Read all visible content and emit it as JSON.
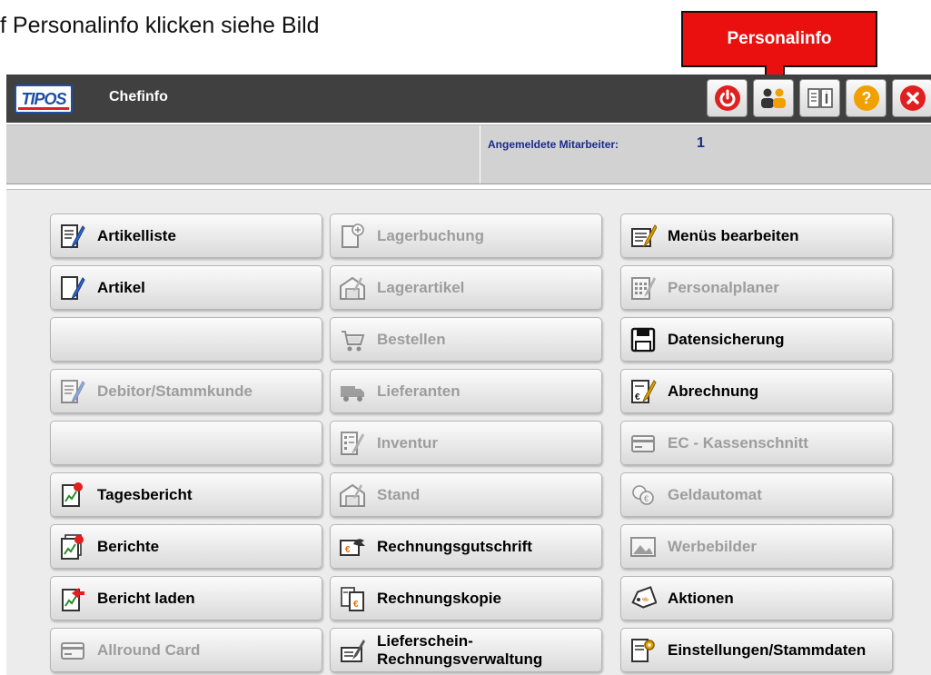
{
  "caption": "f Personalinfo klicken siehe Bild",
  "callout": {
    "label": "Personalinfo"
  },
  "window": {
    "logo_text": "TIPOS",
    "title": "Chefinfo",
    "toolbar": [
      {
        "name": "power-button",
        "icon": "power-icon",
        "color": "#e02020"
      },
      {
        "name": "personalinfo-button",
        "icon": "users-icon",
        "color": "#f0a000"
      },
      {
        "name": "info-book-button",
        "icon": "book-icon",
        "color": "#555555"
      },
      {
        "name": "help-button",
        "icon": "question-icon",
        "color": "#f0a000"
      },
      {
        "name": "close-button",
        "icon": "close-icon",
        "color": "#e02020"
      }
    ]
  },
  "status": {
    "label": "Angemeldete Mitarbeiter:",
    "value": "1"
  },
  "menu": {
    "col1": [
      {
        "label": "Artikelliste",
        "enabled": true,
        "icon": "edit-list-icon"
      },
      {
        "label": "Artikel",
        "enabled": true,
        "icon": "edit-document-icon"
      },
      {
        "label": "",
        "enabled": true,
        "icon": ""
      },
      {
        "label": "Debitor/Stammkunde",
        "enabled": false,
        "icon": "edit-list-icon"
      },
      {
        "label": "",
        "enabled": true,
        "icon": ""
      },
      {
        "label": "Tagesbericht",
        "enabled": true,
        "icon": "report-icon"
      },
      {
        "label": "Berichte",
        "enabled": true,
        "icon": "reports-icon"
      },
      {
        "label": "Bericht laden",
        "enabled": true,
        "icon": "load-report-icon"
      },
      {
        "label": "Allround Card",
        "enabled": false,
        "icon": "card-icon"
      }
    ],
    "col2": [
      {
        "label": "Lagerbuchung",
        "enabled": false,
        "icon": "add-document-icon"
      },
      {
        "label": "Lagerartikel",
        "enabled": false,
        "icon": "warehouse-icon"
      },
      {
        "label": "Bestellen",
        "enabled": false,
        "icon": "cart-icon"
      },
      {
        "label": "Lieferanten",
        "enabled": false,
        "icon": "truck-icon"
      },
      {
        "label": "Inventur",
        "enabled": false,
        "icon": "checklist-icon"
      },
      {
        "label": "Stand",
        "enabled": false,
        "icon": "warehouse-icon"
      },
      {
        "label": "Rechnungsgutschrift",
        "enabled": true,
        "icon": "credit-note-icon"
      },
      {
        "label": "Rechnungskopie",
        "enabled": true,
        "icon": "invoice-copy-icon"
      },
      {
        "label": "Lieferschein-\nRechnungsverwaltung",
        "enabled": true,
        "icon": "delivery-note-icon"
      }
    ],
    "col3": [
      {
        "label": "Menüs bearbeiten",
        "enabled": true,
        "icon": "edit-menu-icon"
      },
      {
        "label": "Personalplaner",
        "enabled": false,
        "icon": "calendar-icon"
      },
      {
        "label": "Datensicherung",
        "enabled": true,
        "icon": "floppy-icon"
      },
      {
        "label": "Abrechnung",
        "enabled": true,
        "icon": "billing-icon"
      },
      {
        "label": "EC - Kassenschnitt",
        "enabled": false,
        "icon": "card-icon"
      },
      {
        "label": "Geldautomat",
        "enabled": false,
        "icon": "coins-icon"
      },
      {
        "label": "Werbebilder",
        "enabled": false,
        "icon": "image-icon"
      },
      {
        "label": "Aktionen",
        "enabled": true,
        "icon": "tag-icon"
      },
      {
        "label": "Einstellungen/Stammdaten",
        "enabled": true,
        "icon": "settings-document-icon"
      }
    ]
  }
}
